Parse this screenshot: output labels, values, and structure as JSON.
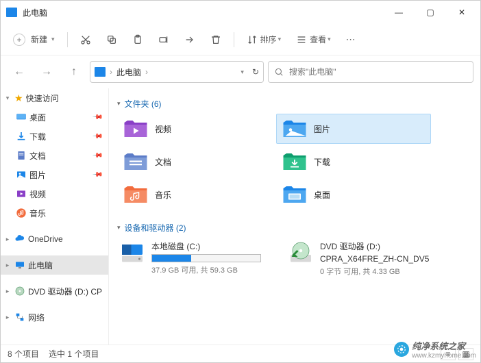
{
  "title": "此电脑",
  "toolbar": {
    "new": "新建",
    "sort": "排序",
    "view": "查看"
  },
  "address": {
    "crumbs": [
      "此电脑"
    ]
  },
  "search": {
    "placeholder": "搜索\"此电脑\""
  },
  "sidebar": {
    "quick": "快速访问",
    "quick_items": [
      {
        "label": "桌面"
      },
      {
        "label": "下载"
      },
      {
        "label": "文档"
      },
      {
        "label": "图片"
      },
      {
        "label": "视频"
      },
      {
        "label": "音乐"
      }
    ],
    "onedrive": "OneDrive",
    "this_pc": "此电脑",
    "dvd": "DVD 驱动器 (D:) CP",
    "network": "网络"
  },
  "groups": {
    "folders": {
      "label": "文件夹 (6)"
    },
    "drives": {
      "label": "设备和驱动器 (2)"
    }
  },
  "folders": [
    {
      "label": "视频"
    },
    {
      "label": "图片"
    },
    {
      "label": "文档"
    },
    {
      "label": "下载"
    },
    {
      "label": "音乐"
    },
    {
      "label": "桌面"
    }
  ],
  "drives": {
    "c": {
      "name": "本地磁盘 (C:)",
      "details": "37.9 GB 可用, 共 59.3 GB",
      "fill_pct": 36
    },
    "d": {
      "name": "DVD 驱动器 (D:)",
      "sub": "CPRA_X64FRE_ZH-CN_DV5",
      "details": "0 字节 可用, 共 4.33 GB"
    }
  },
  "status": {
    "count": "8 个项目",
    "selected": "选中 1 个项目"
  },
  "watermark": {
    "text": "纯净系统之家",
    "url": "www.kzmyhome.com"
  }
}
